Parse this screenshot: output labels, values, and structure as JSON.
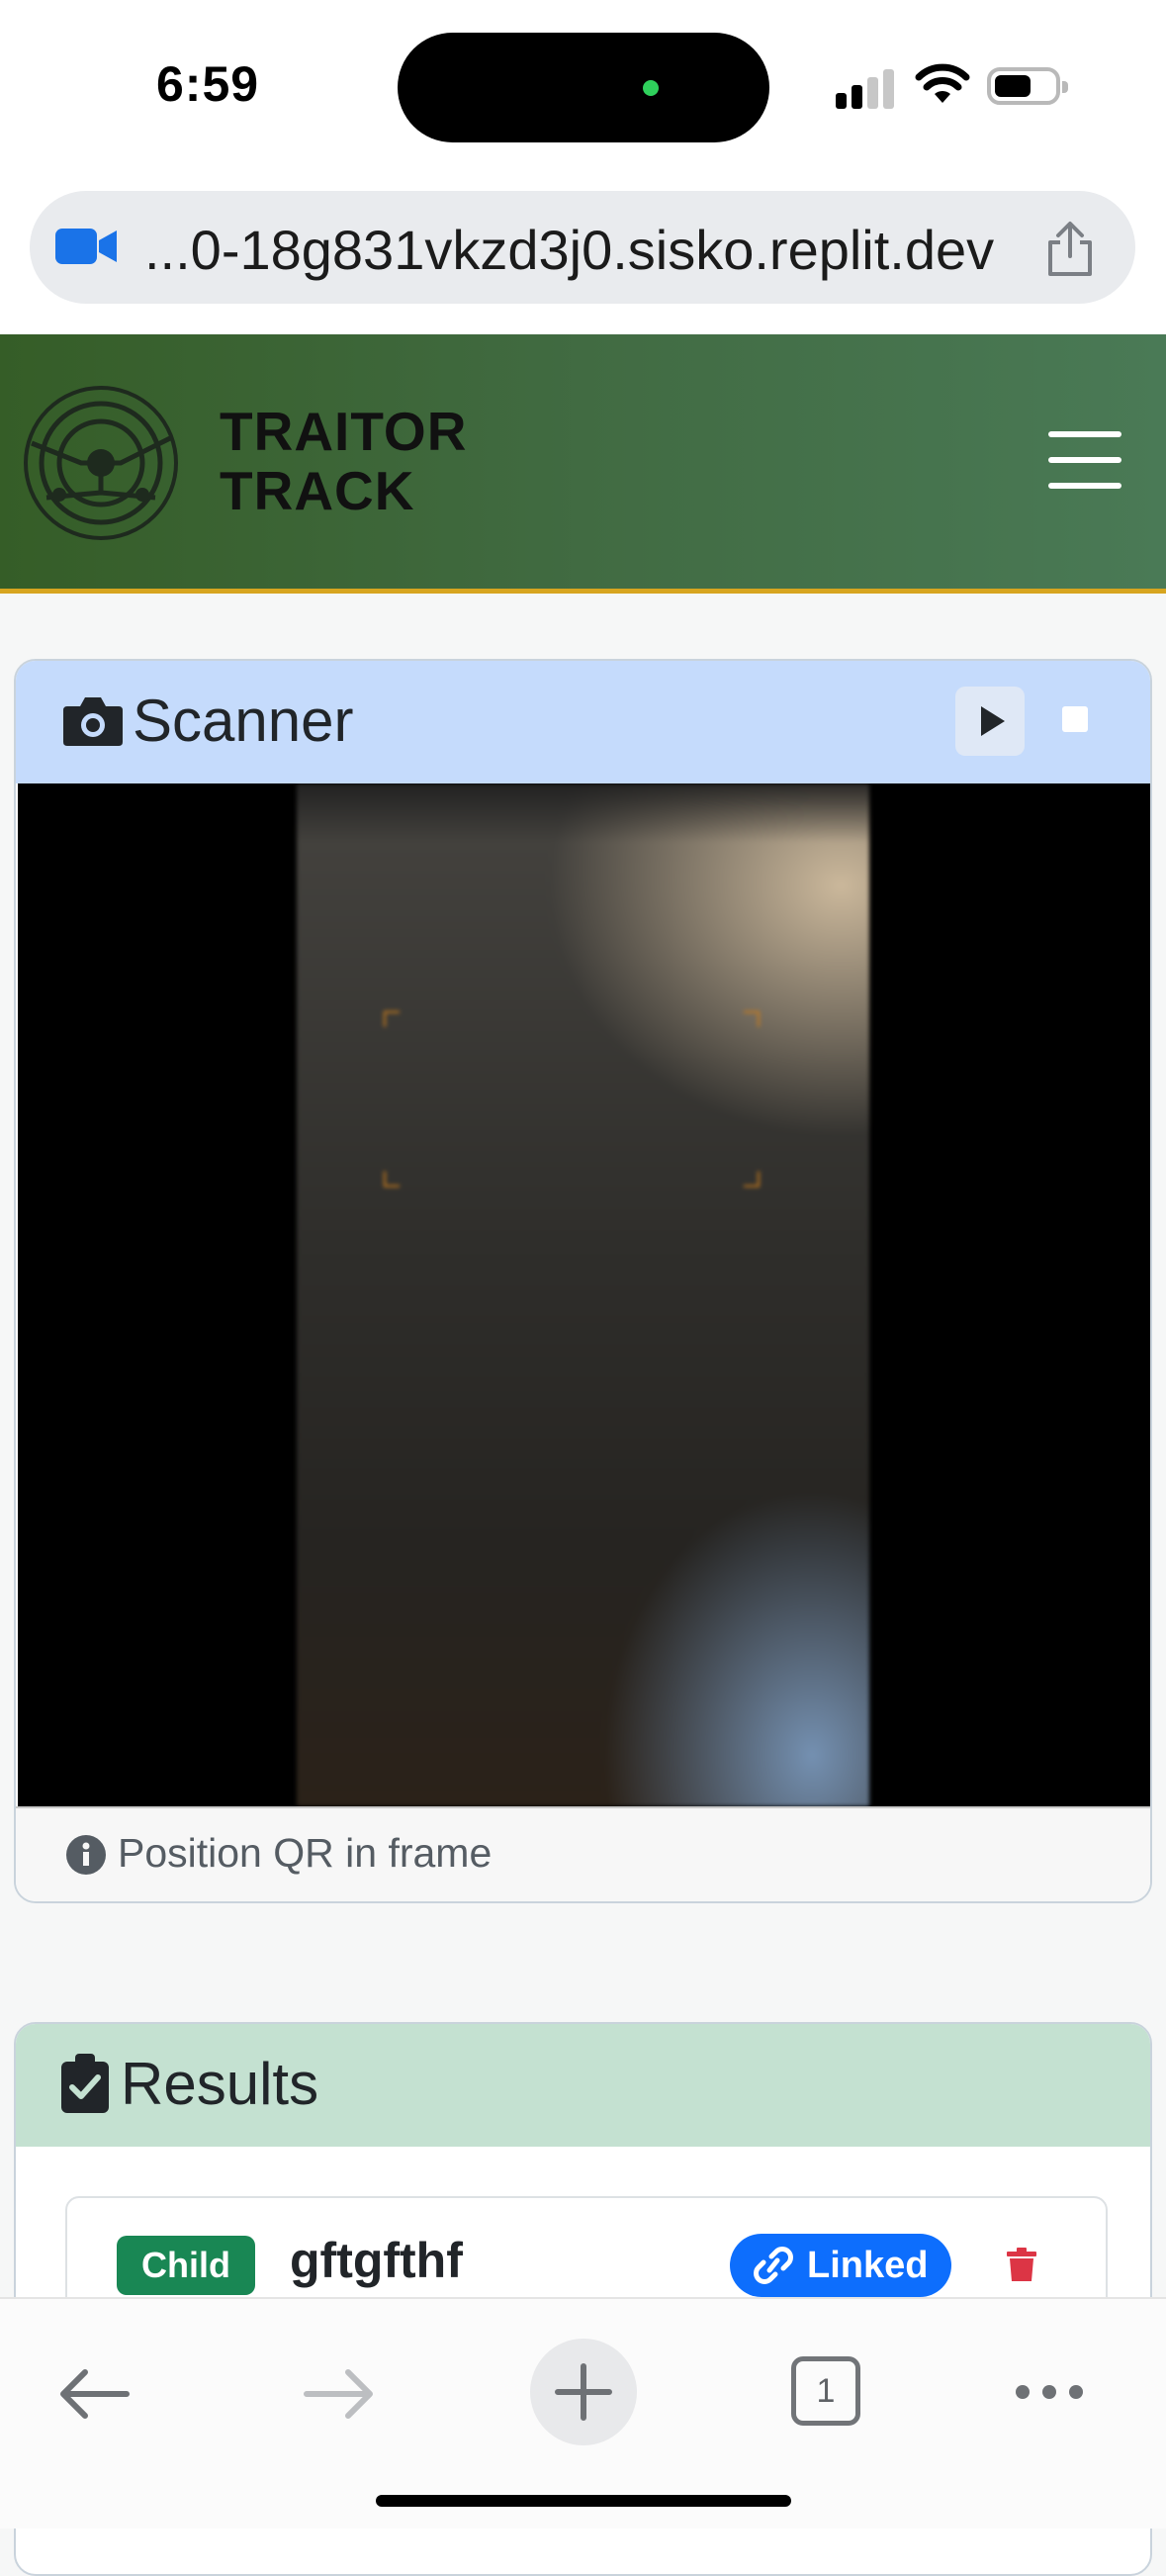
{
  "status_bar": {
    "time": "6:59"
  },
  "browser": {
    "url": "...0-18g831vkzd3j0.sisko.replit.dev",
    "tab_count": "1"
  },
  "app": {
    "brand_line1": "TRAITOR",
    "brand_line2": "TRACK",
    "accent_colors": {
      "header_green": "#355d27",
      "header_border": "#d7a51f"
    }
  },
  "scanner": {
    "title": "Scanner",
    "caption": "Position QR in frame",
    "icons": {
      "title": "camera-icon",
      "play": "play-icon",
      "stop": "stop-icon",
      "caption": "info-icon"
    }
  },
  "results": {
    "title": "Results",
    "items": [
      {
        "type": "Child",
        "name": "gftgfthf",
        "status": "Linked"
      }
    ],
    "colors": {
      "child_badge": "#198754",
      "linked_badge": "#0d6efd",
      "delete": "#dc3545"
    }
  }
}
